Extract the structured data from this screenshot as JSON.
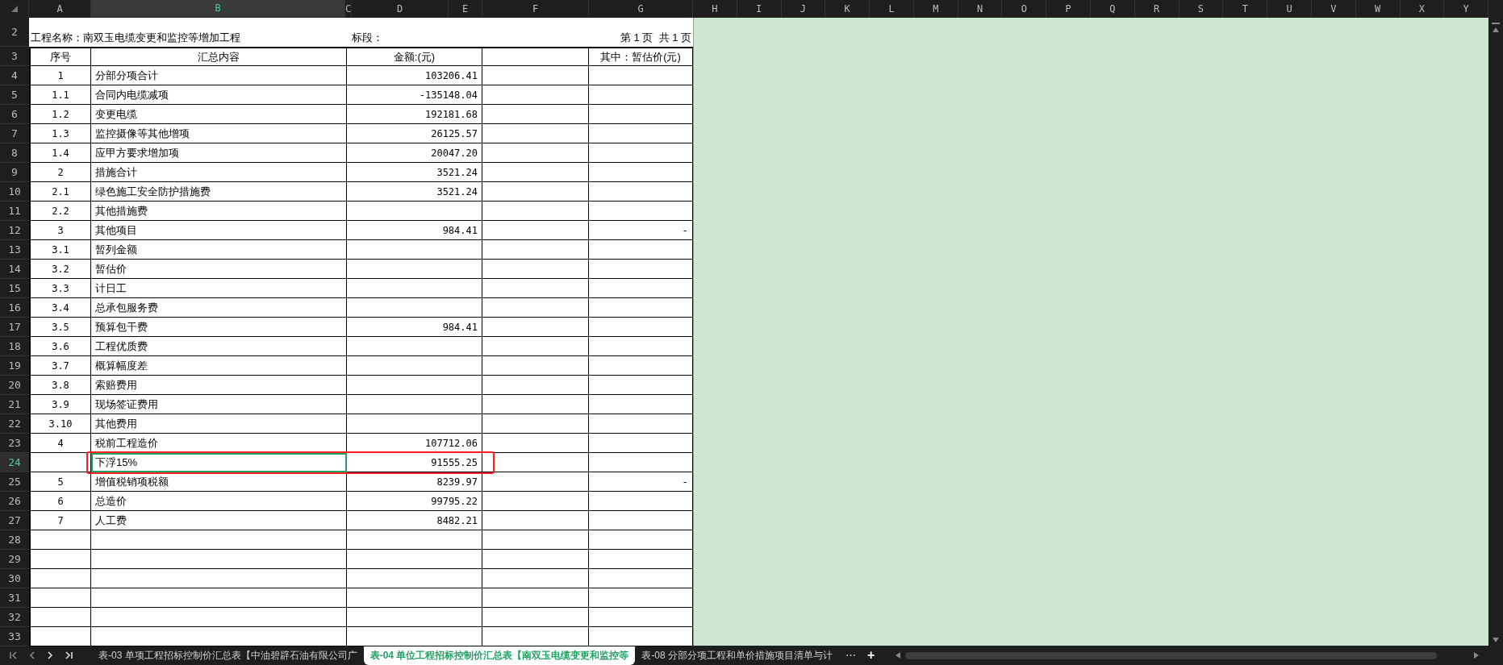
{
  "column_headers": [
    {
      "label": "A",
      "selected": false
    },
    {
      "label": "B",
      "selected": true
    },
    {
      "label": "C",
      "selected": false
    },
    {
      "label": "D",
      "selected": false
    },
    {
      "label": "E",
      "selected": false
    },
    {
      "label": "F",
      "selected": false
    },
    {
      "label": "G",
      "selected": false
    },
    {
      "label": "H",
      "selected": false
    },
    {
      "label": "I",
      "selected": false
    },
    {
      "label": "J",
      "selected": false
    },
    {
      "label": "K",
      "selected": false
    },
    {
      "label": "L",
      "selected": false
    },
    {
      "label": "M",
      "selected": false
    },
    {
      "label": "N",
      "selected": false
    },
    {
      "label": "O",
      "selected": false
    },
    {
      "label": "P",
      "selected": false
    },
    {
      "label": "Q",
      "selected": false
    },
    {
      "label": "R",
      "selected": false
    },
    {
      "label": "S",
      "selected": false
    },
    {
      "label": "T",
      "selected": false
    },
    {
      "label": "U",
      "selected": false
    },
    {
      "label": "V",
      "selected": false
    },
    {
      "label": "W",
      "selected": false
    },
    {
      "label": "X",
      "selected": false
    },
    {
      "label": "Y",
      "selected": false
    }
  ],
  "title_row": {
    "row_number": "2",
    "project_label": "工程名称：南双玉电缆变更和监控等增加工程",
    "section_label": "标段：",
    "page_label": "第 1 页  共 1 页"
  },
  "table": {
    "header_row_number": "3",
    "columns": {
      "number": "序号",
      "content": "汇总内容",
      "amount": "金额:(元)",
      "estimate": "其中：暂估价(元)"
    },
    "rows": [
      {
        "row_number": "4",
        "number": "1",
        "content": "分部分项合计",
        "amount": "103206.41",
        "selected": false,
        "highlighted": false
      },
      {
        "row_number": "5",
        "number": "1.1",
        "content": "合同内电缆减项",
        "amount": "-135148.04",
        "selected": false,
        "highlighted": false
      },
      {
        "row_number": "6",
        "number": "1.2",
        "content": "变更电缆",
        "amount": "192181.68",
        "selected": false,
        "highlighted": false
      },
      {
        "row_number": "7",
        "number": "1.3",
        "content": "监控摄像等其他增项",
        "amount": "26125.57",
        "selected": false,
        "highlighted": false
      },
      {
        "row_number": "8",
        "number": "1.4",
        "content": "应甲方要求增加项",
        "amount": "20047.20",
        "selected": false,
        "highlighted": false
      },
      {
        "row_number": "9",
        "number": "2",
        "content": "措施合计",
        "amount": "3521.24",
        "selected": false,
        "highlighted": false
      },
      {
        "row_number": "10",
        "number": "2.1",
        "content": "绿色施工安全防护措施费",
        "amount": "3521.24",
        "selected": false,
        "highlighted": false
      },
      {
        "row_number": "11",
        "number": "2.2",
        "content": "其他措施费",
        "selected": false,
        "highlighted": false
      },
      {
        "row_number": "12",
        "number": "3",
        "content": "其他项目",
        "amount": "984.41",
        "estimate": "-",
        "selected": false,
        "highlighted": false
      },
      {
        "row_number": "13",
        "number": "3.1",
        "content": "暂列金额",
        "selected": false,
        "highlighted": false
      },
      {
        "row_number": "14",
        "number": "3.2",
        "content": "暂估价",
        "selected": false,
        "highlighted": false
      },
      {
        "row_number": "15",
        "number": "3.3",
        "content": "计日工",
        "selected": false,
        "highlighted": false
      },
      {
        "row_number": "16",
        "number": "3.4",
        "content": "总承包服务费",
        "selected": false,
        "highlighted": false
      },
      {
        "row_number": "17",
        "number": "3.5",
        "content": "预算包干费",
        "amount": "984.41",
        "selected": false,
        "highlighted": false
      },
      {
        "row_number": "18",
        "number": "3.6",
        "content": "工程优质费",
        "selected": false,
        "highlighted": false
      },
      {
        "row_number": "19",
        "number": "3.7",
        "content": "概算幅度差",
        "selected": false,
        "highlighted": false
      },
      {
        "row_number": "20",
        "number": "3.8",
        "content": "索赔费用",
        "selected": false,
        "highlighted": false
      },
      {
        "row_number": "21",
        "number": "3.9",
        "content": "现场签证费用",
        "selected": false,
        "highlighted": false
      },
      {
        "row_number": "22",
        "number": "3.10",
        "content": "其他费用",
        "selected": false,
        "highlighted": false
      },
      {
        "row_number": "23",
        "number": "4",
        "content": "税前工程造价",
        "amount": "107712.06",
        "selected": false,
        "highlighted": false
      },
      {
        "row_number": "24",
        "content": "下浮15%",
        "amount": "91555.25",
        "selected": true,
        "highlighted": true
      },
      {
        "row_number": "25",
        "number": "5",
        "content": "增值税销项税额",
        "amount": "8239.97",
        "estimate": "-",
        "selected": false,
        "highlighted": false
      },
      {
        "row_number": "26",
        "number": "6",
        "content": "总造价",
        "amount": "99795.22",
        "selected": false,
        "highlighted": false
      },
      {
        "row_number": "27",
        "number": "7",
        "content": "人工费",
        "amount": "8482.21",
        "selected": false,
        "highlighted": false
      },
      {
        "row_number": "28",
        "selected": false,
        "highlighted": false
      },
      {
        "row_number": "29",
        "selected": false,
        "highlighted": false
      },
      {
        "row_number": "30",
        "selected": false,
        "highlighted": false
      },
      {
        "row_number": "31",
        "selected": false,
        "highlighted": false
      },
      {
        "row_number": "32",
        "selected": false,
        "highlighted": false
      },
      {
        "row_number": "33",
        "selected": false,
        "highlighted": false
      }
    ]
  },
  "sheet_tabs": [
    {
      "label": "表-03 单项工程招标控制价汇总表【中油碧辟石油有限公司广",
      "selected": false
    },
    {
      "label": "表-04 单位工程招标控制价汇总表【南双玉电缆变更和监控等",
      "selected": true
    },
    {
      "label": "表-08 分部分项工程和单价措施项目清单与计",
      "selected": false
    }
  ],
  "more_tabs": "⋯",
  "add_tab": "+"
}
